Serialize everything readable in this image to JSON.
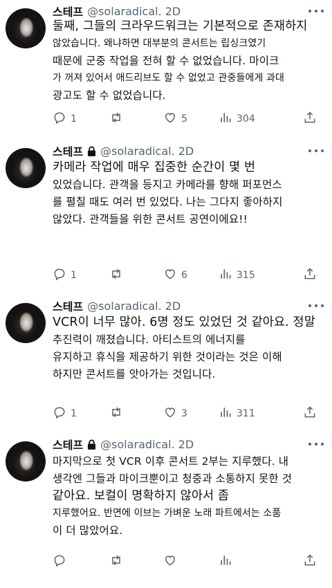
{
  "tweets": [
    {
      "author": "스테프",
      "handle": "@solaradical. 2D",
      "locked": false,
      "lines": [
        {
          "text": "둘째, 그들의 크라우드워크는 기본적으로 존재하지",
          "size": "big"
        },
        {
          "text": "않았습니다. 왜냐하면 대부분의 콘서트는 립싱크였기",
          "size": "small"
        },
        {
          "text": "때문에 군중 작업을 전혀 할 수 없었습니다. 마이크",
          "size": "normal"
        },
        {
          "text": "가 꺼져 있어서 애드리브도 할 수 없었고 관중들에게 과대",
          "size": "small"
        },
        {
          "text": "광고도 할 수 없었습니다.",
          "size": "normal"
        }
      ],
      "replies": "1",
      "likes": "5",
      "views": "304"
    },
    {
      "author": "스테프",
      "handle": "@solaradical. 2D",
      "locked": true,
      "lines": [
        {
          "text": "카메라 작업에 매우 집중한 순간이 몇 번",
          "size": "big"
        },
        {
          "text": "있었습니다. 관객을 등지고 카메라를 향해 퍼포먼스",
          "size": "normal"
        },
        {
          "text": "를 펼칠 때도 여러 번 있었다. 나는 그다지 좋아하지",
          "size": "normal"
        },
        {
          "text": "않았다. 관객들을 위한 콘서트 공연이에요!!",
          "size": "normal"
        }
      ],
      "replies": "1",
      "likes": "6",
      "views": "315"
    },
    {
      "author": "스테프",
      "handle": "@solaradical. 2D",
      "locked": false,
      "lines": [
        {
          "text": "VCR이 너무 많아. 6명 정도 있었던 것 같아요. 정말",
          "size": "big"
        },
        {
          "text": "추진력이 깨졌습니다. 아티스트의 에너지를",
          "size": "normal"
        },
        {
          "text": "유지하고 휴식을 제공하기 위한 것이라는 것은 이해",
          "size": "normal"
        },
        {
          "text": "하지만 콘서트를 앗아가는 것입니다.",
          "size": "normal"
        }
      ],
      "replies": "1",
      "likes": "3",
      "views": "311"
    },
    {
      "author": "스테프",
      "handle": "@solaradical. 2D",
      "locked": true,
      "lines": [
        {
          "text": "마지막으로 첫 VCR 이후 콘서트 2부는 지루했다. 내",
          "size": "normal"
        },
        {
          "text": "생각엔 그들과 마이크뿐이고 청중과 소통하지 못한 것",
          "size": "normal"
        },
        {
          "text": "같아요. 보컬이 명확하지 않아서 좀",
          "size": "big"
        },
        {
          "text": "지루했어요. 반면에 이브는 가벼운 노래 파트에서는 소품",
          "size": "small"
        },
        {
          "text": "이 더 많았어요.",
          "size": "normal"
        }
      ],
      "replies": "",
      "likes": "",
      "views": ""
    }
  ],
  "icons": {
    "reply": "reply-icon",
    "retweet": "retweet-icon",
    "like": "heart-icon",
    "views": "views-icon",
    "more": "more-icon",
    "lock": "lock-icon"
  },
  "colors": {
    "text": "#0f1419",
    "muted": "#536471",
    "background": "#ffffff"
  }
}
